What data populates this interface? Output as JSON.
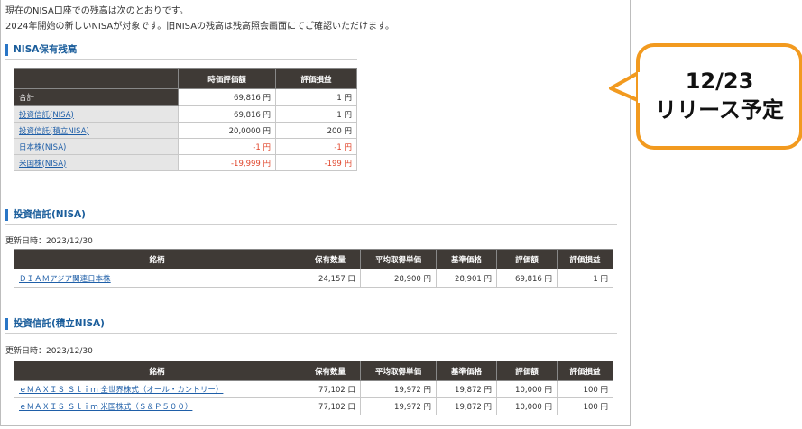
{
  "intro": {
    "line1": "現在のNISA口座での残高は次のとおりです。",
    "line2": "2024年開始の新しいNISAが対象です。旧NISAの残高は残高照会画面にてご確認いただけます。"
  },
  "holdings": {
    "title": "NISA保有残高",
    "headers": [
      "時価評価額",
      "評価損益"
    ],
    "rows": [
      {
        "label": "合計",
        "value": "69,816 円",
        "pl": "1 円"
      },
      {
        "label": "投資信託(NISA)",
        "value": "69,816 円",
        "pl": "1 円"
      },
      {
        "label": "投資信託(積立NISA)",
        "value": "20,0000 円",
        "pl": "200 円"
      },
      {
        "label": "日本株(NISA)",
        "value": "-1 円",
        "pl": "-1 円"
      },
      {
        "label": "米国株(NISA)",
        "value": "-19,999 円",
        "pl": "-199 円"
      }
    ]
  },
  "fund_nisa": {
    "title": "投資信託(NISA)",
    "updated": "更新日時：2023/12/30",
    "headers": [
      "銘柄",
      "保有数量",
      "平均取得単価",
      "基準価格",
      "評価額",
      "評価損益"
    ],
    "rows": [
      {
        "name": "ＤＩＡＭアジア関連日本株",
        "qty": "24,157 口",
        "avg": "28,900 円",
        "base": "28,901 円",
        "val": "69,816 円",
        "pl": "1 円"
      }
    ]
  },
  "fund_tsumitate": {
    "title": "投資信託(積立NISA)",
    "updated": "更新日時：2023/12/30",
    "headers": [
      "銘柄",
      "保有数量",
      "平均取得単価",
      "基準価格",
      "評価額",
      "評価損益"
    ],
    "rows": [
      {
        "name": "ｅＭＡＸＩＳ Ｓｌｉｍ 全世界株式（オール・カントリー）",
        "qty": "77,102 口",
        "avg": "19,972 円",
        "base": "19,872 円",
        "val": "10,000 円",
        "pl": "100 円"
      },
      {
        "name": "ｅＭＡＸＩＳ Ｓｌｉｍ 米国株式（Ｓ＆Ｐ５００）",
        "qty": "77,102 口",
        "avg": "19,972 円",
        "base": "19,872 円",
        "val": "10,000 円",
        "pl": "100 円"
      }
    ]
  },
  "callout": {
    "line1": "12/23",
    "line2": "リリース予定"
  },
  "colors": {
    "header_bg": "#3f3a36",
    "link": "#1f5fa8",
    "negative": "#e0442a",
    "heading_accent": "#2a76c6",
    "callout_border": "#f29a1f"
  }
}
